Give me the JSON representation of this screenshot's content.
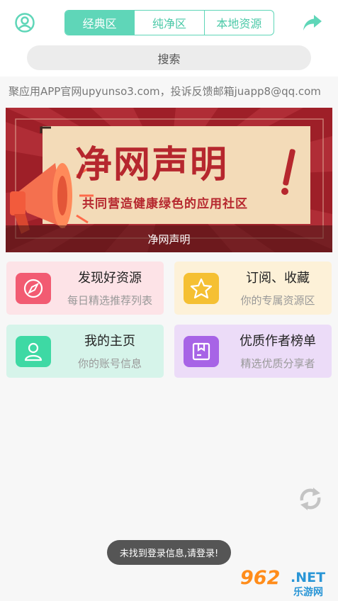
{
  "header": {
    "tabs": [
      {
        "label": "经典区",
        "active": true
      },
      {
        "label": "纯净区",
        "active": false
      },
      {
        "label": "本地资源",
        "active": false
      }
    ],
    "search_label": "搜索",
    "accent_color": "#5fd6b8"
  },
  "notice": "聚应用APP官网upyunso3.com，投诉反馈邮箱juapp8@qq.com",
  "banner": {
    "title": "净网声明",
    "subtitle": "共同营造健康绿色的应用社区",
    "caption": "净网声明"
  },
  "cards": [
    {
      "title": "发现好资源",
      "desc": "每日精选推荐列表",
      "icon": "compass-icon",
      "bg": "#fde3e7",
      "icon_color": "#f25b72"
    },
    {
      "title": "订阅、收藏",
      "desc": "你的专属资源区",
      "icon": "star-icon",
      "bg": "#fdf1d8",
      "icon_color": "#f5c033"
    },
    {
      "title": "我的主页",
      "desc": "你的账号信息",
      "icon": "user-icon",
      "bg": "#d6f4ea",
      "icon_color": "#3ed9a4"
    },
    {
      "title": "优质作者榜单",
      "desc": "精选优质分享者",
      "icon": "box-icon",
      "bg": "#ecdcf8",
      "icon_color": "#a764e6"
    }
  ],
  "toast": "未找到登录信息,请登录!",
  "watermark": {
    "number": "962",
    "net": ".NET",
    "site": "乐游网"
  }
}
